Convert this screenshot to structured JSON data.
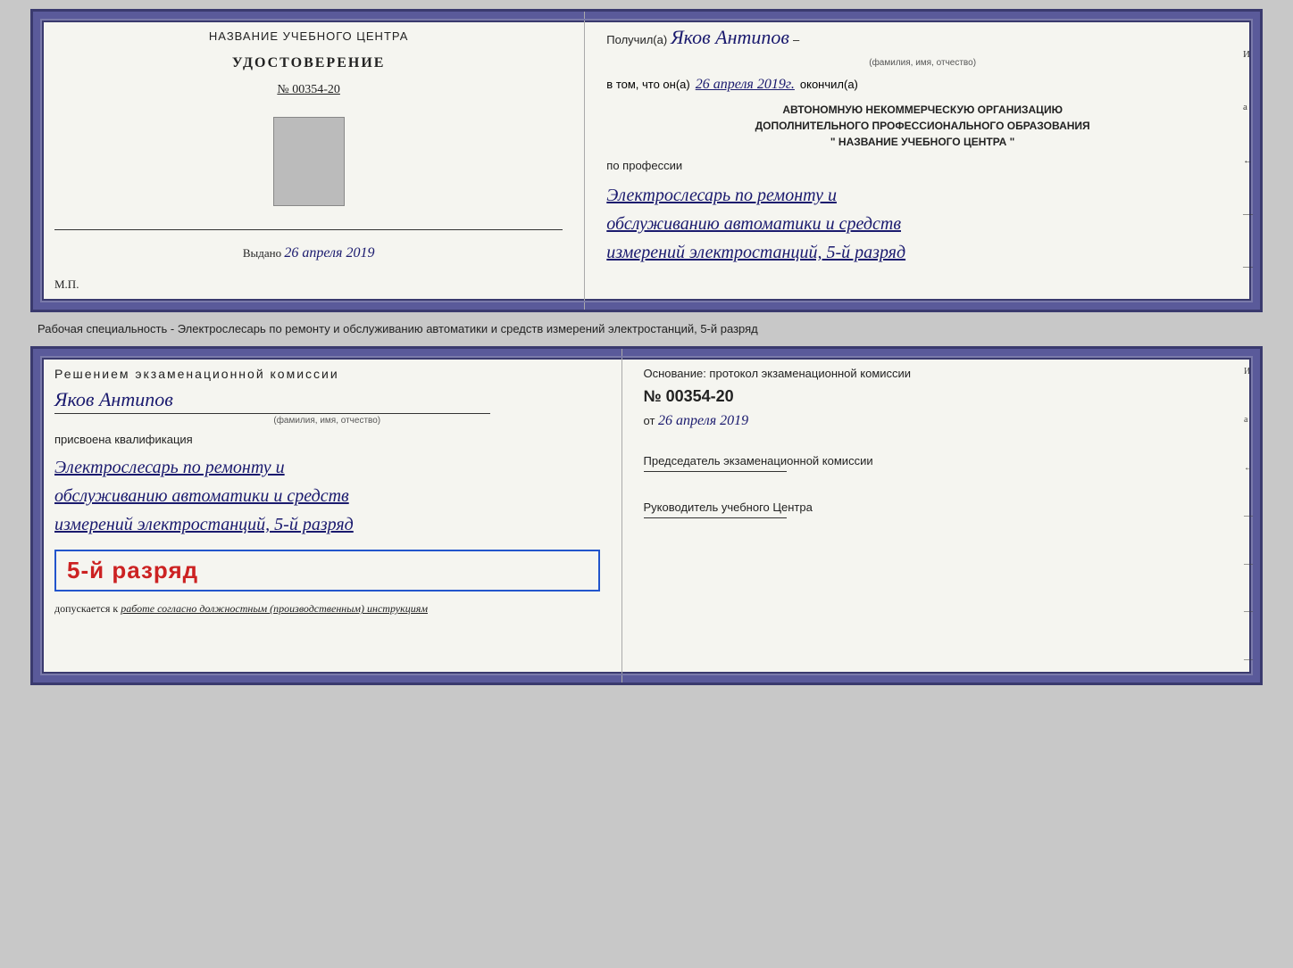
{
  "top_left": {
    "center_title": "НАЗВАНИЕ УЧЕБНОГО ЦЕНТРА",
    "cert_label": "УДОСТОВЕРЕНИЕ",
    "cert_number": "№ 00354-20",
    "photo_alt": "фото",
    "issued_label": "Выдано",
    "issued_date": "26 апреля 2019",
    "mp": "М.П."
  },
  "top_right": {
    "received_prefix": "Получил(а)",
    "recipient_name": "Яков Антипов",
    "fio_label": "(фамилия, имя, отчество)",
    "in_that_prefix": "в том, что он(а)",
    "completion_date": "26 апреля 2019г.",
    "finished_label": "окончил(а)",
    "org_line1": "АВТОНОМНУЮ НЕКОММЕРЧЕСКУЮ ОРГАНИЗАЦИЮ",
    "org_line2": "ДОПОЛНИТЕЛЬНОГО ПРОФЕССИОНАЛЬНОГО ОБРАЗОВАНИЯ",
    "org_line3": "\" НАЗВАНИЕ УЧЕБНОГО ЦЕНТРА \"",
    "profession_label": "по профессии",
    "profession_text": "Электрослесарь по ремонту и обслуживанию автоматики и средств измерений электростанций, 5-й разряд",
    "side_chars": [
      "И",
      "а",
      "←",
      "—",
      "—",
      "—",
      "—"
    ]
  },
  "middle_text": "Рабочая специальность - Электрослесарь по ремонту и обслуживанию автоматики и средств измерений электростанций, 5-й разряд",
  "bottom_left": {
    "decision_header": "Решением  экзаменационной  комиссии",
    "person_name": "Яков Антипов",
    "fio_label": "(фамилия, имя, отчество)",
    "qualification_label": "присвоена квалификация",
    "profession_text": "Электрослесарь по ремонту и обслуживанию автоматики и средств измерений электростанций, 5-й разряд",
    "rank_text": "5-й разряд",
    "допуск_prefix": "допускается к",
    "допуск_text": "работе согласно должностным (производственным) инструкциям"
  },
  "bottom_right": {
    "basis_label": "Основание: протокол экзаменационной  комиссии",
    "number_label": "№ 00354-20",
    "date_prefix": "от",
    "date_value": "26 апреля 2019",
    "chairman_label": "Председатель экзаменационной комиссии",
    "head_label": "Руководитель учебного Центра",
    "side_chars": [
      "И",
      "а",
      "←",
      "—",
      "—",
      "—",
      "—"
    ]
  }
}
